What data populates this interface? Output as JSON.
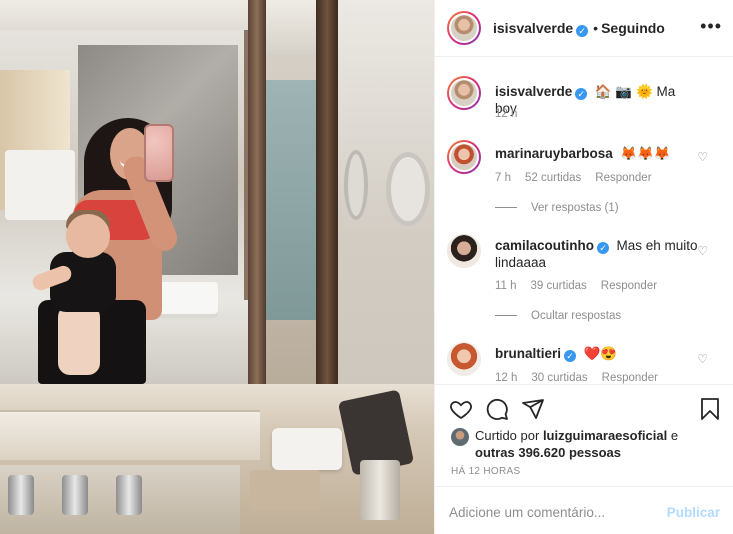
{
  "post": {
    "author": "isisvalverde",
    "follow_state": "Seguindo",
    "separator": "•",
    "more": "•••"
  },
  "caption": {
    "username": "isisvalverde",
    "text": "🏠 📷 🌞 Ma boy",
    "time": "12 h"
  },
  "comments": [
    {
      "username": "marinaruybarbosa",
      "text": "🦊🦊🦊",
      "time": "7 h",
      "likes": "52 curtidas",
      "reply": "Responder",
      "replies_toggle": "Ver respostas (1)"
    },
    {
      "username": "camilacoutinho",
      "text": "Mas eh muito lindaaaa",
      "time": "11 h",
      "likes": "39 curtidas",
      "reply": "Responder",
      "replies_toggle": "Ocultar respostas"
    },
    {
      "username": "brunaltieri",
      "text": "❤️😍",
      "time": "12 h",
      "likes": "30 curtidas",
      "reply": "Responder"
    }
  ],
  "likes": {
    "prefix": "Curtido por",
    "user": "luizguimaraesoficial",
    "connector": "e",
    "others": "outras 396.620 pessoas"
  },
  "timestamp": "HÁ 12 HORAS",
  "add_comment": {
    "placeholder": "Adicione um comentário...",
    "publish": "Publicar"
  },
  "colors": {
    "verified": "#3897f0",
    "publish_disabled": "#b3dbff",
    "secondary_text": "#8e8e8e"
  },
  "icons": [
    "heart-icon",
    "comment-icon",
    "share-icon",
    "bookmark-icon",
    "verified-icon",
    "more-icon"
  ]
}
